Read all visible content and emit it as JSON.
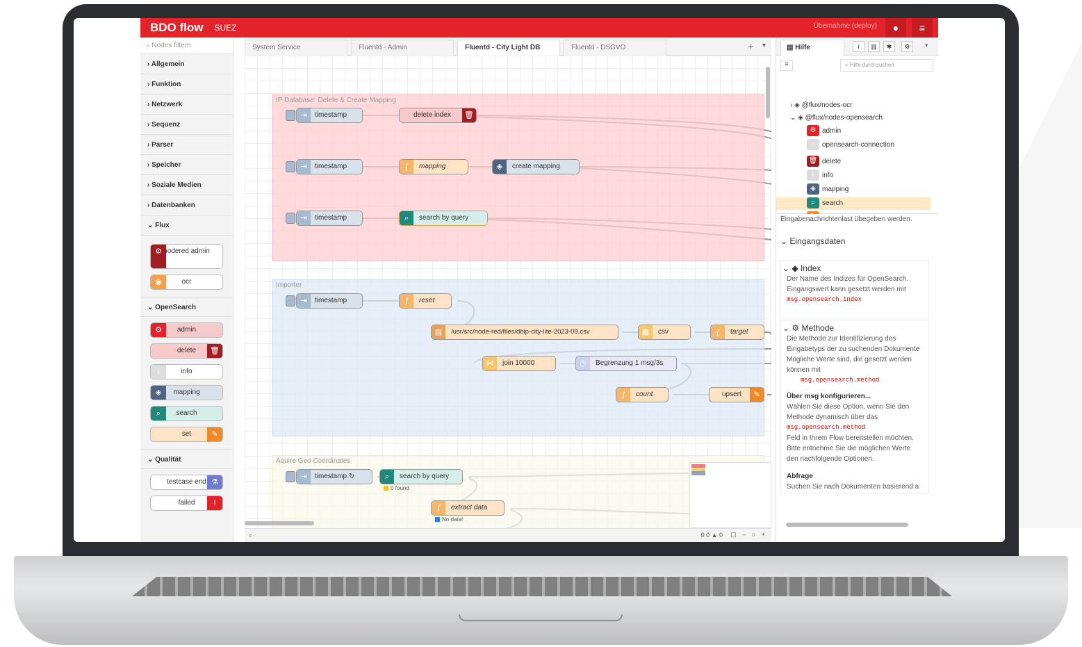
{
  "header": {
    "brand": "BDO flow",
    "subtitle": "SUEZ",
    "deploy_label": "Übernahme (deploy)"
  },
  "palette": {
    "filter_placeholder": "Nodes filtern",
    "categories": [
      "Allgemein",
      "Funktion",
      "Netzwerk",
      "Sequenz",
      "Parser",
      "Speicher",
      "Soziale Medien",
      "Datenbanken",
      "Flux"
    ],
    "flux_nodes": [
      "nodered admin",
      "ocr"
    ],
    "opensearch_label": "OpenSearch",
    "opensearch_nodes": [
      "admin",
      "delete",
      "info",
      "mapping",
      "search",
      "set"
    ],
    "qualitaet_label": "Qualität",
    "qualitaet_nodes": [
      "testcase end",
      "failed"
    ]
  },
  "tabs": [
    "System Service",
    "Fluentd - Admin",
    "Fluentd - City Light DB",
    "Fluentd - DSGVO"
  ],
  "active_tab": "Fluentd - City Light DB",
  "groups": {
    "g1": "IP Database: Delete & Create Mapping",
    "g2": "Importer",
    "g3": "Aquire Geo Coordinates"
  },
  "nodes": {
    "ts1": "timestamp",
    "delete_index": "delete index",
    "ts2": "timestamp",
    "mapping": "mapping",
    "create_mapping": "create mapping",
    "ts3": "timestamp",
    "search_by_query": "search by query",
    "ts4": "timestamp",
    "reset": "reset",
    "file": "/usr/src/node-red/files/dbip-city-lite-2023-09.csv",
    "csv": "csv",
    "target": "target",
    "join": "join 10000",
    "limit": "Begrenzung 1 msg/3s",
    "count": "count",
    "upsert": "upsert",
    "ts5": "timestamp ↻",
    "search2": "search by query",
    "search2_status": "0 found",
    "extract": "extract data",
    "extract_status": "No data!"
  },
  "footer": {
    "counts": "0 0 ▲ 0"
  },
  "sidebar": {
    "tab": "Hilfe",
    "search_placeholder": "Hilfe durchsuchen",
    "tree": [
      "@flux/nodes-ocr",
      "@flux/nodes-opensearch",
      "admin",
      "opensearch-connection",
      "delete",
      "info",
      "mapping",
      "search",
      "set"
    ],
    "intro": "Eingabenachrichtenlast übegeben werden.",
    "eingangsdaten": "Eingangsdaten",
    "index_title": "Index",
    "index_text": "Der Name des Indizes für OpenSearch. Eingangswert kann gesetzt werden mit",
    "index_code": "msg.opensearch.index",
    "methode_title": "Methode",
    "methode_text1": "Die Methode zur Identifizierung des Eingabetyps der zu suchenden Dokumente",
    "methode_text2": "Mögliche Werte sind, die gesetzt werden können mit",
    "methode_code": "msg.opensearch.method",
    "konf_title": "Über msg konfigurieren...",
    "konf_text1": "Wählen Sie diese Option, wenn Sie den Methode dynamisch über das",
    "konf_code": "msg.opensearch.method",
    "konf_text2": "Feld in Ihrem Flow bereitstellen möchten. Bitte entnehme Sie die möglichen Werte den nachfolgende Optionen.",
    "abfrage_title": "Abfrage",
    "abfrage_text": "Suchen Sie nach Dokumenten basierend a"
  }
}
